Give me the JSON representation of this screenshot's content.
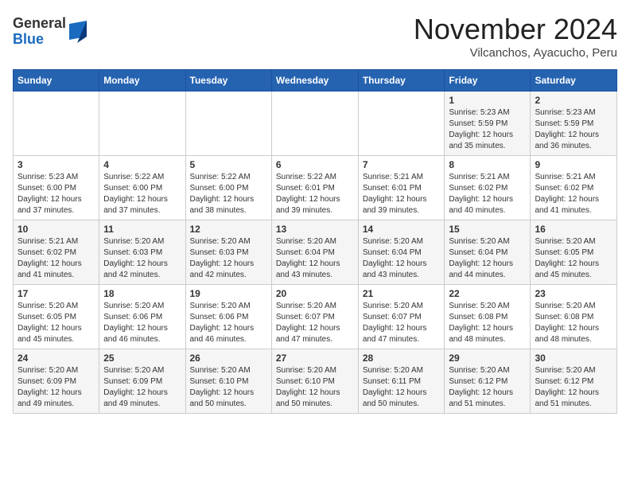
{
  "header": {
    "logo_general": "General",
    "logo_blue": "Blue",
    "month": "November 2024",
    "location": "Vilcanchos, Ayacucho, Peru"
  },
  "weekdays": [
    "Sunday",
    "Monday",
    "Tuesday",
    "Wednesday",
    "Thursday",
    "Friday",
    "Saturday"
  ],
  "weeks": [
    [
      {
        "day": "",
        "info": ""
      },
      {
        "day": "",
        "info": ""
      },
      {
        "day": "",
        "info": ""
      },
      {
        "day": "",
        "info": ""
      },
      {
        "day": "",
        "info": ""
      },
      {
        "day": "1",
        "info": "Sunrise: 5:23 AM\nSunset: 5:59 PM\nDaylight: 12 hours and 35 minutes."
      },
      {
        "day": "2",
        "info": "Sunrise: 5:23 AM\nSunset: 5:59 PM\nDaylight: 12 hours and 36 minutes."
      }
    ],
    [
      {
        "day": "3",
        "info": "Sunrise: 5:23 AM\nSunset: 6:00 PM\nDaylight: 12 hours and 37 minutes."
      },
      {
        "day": "4",
        "info": "Sunrise: 5:22 AM\nSunset: 6:00 PM\nDaylight: 12 hours and 37 minutes."
      },
      {
        "day": "5",
        "info": "Sunrise: 5:22 AM\nSunset: 6:00 PM\nDaylight: 12 hours and 38 minutes."
      },
      {
        "day": "6",
        "info": "Sunrise: 5:22 AM\nSunset: 6:01 PM\nDaylight: 12 hours and 39 minutes."
      },
      {
        "day": "7",
        "info": "Sunrise: 5:21 AM\nSunset: 6:01 PM\nDaylight: 12 hours and 39 minutes."
      },
      {
        "day": "8",
        "info": "Sunrise: 5:21 AM\nSunset: 6:02 PM\nDaylight: 12 hours and 40 minutes."
      },
      {
        "day": "9",
        "info": "Sunrise: 5:21 AM\nSunset: 6:02 PM\nDaylight: 12 hours and 41 minutes."
      }
    ],
    [
      {
        "day": "10",
        "info": "Sunrise: 5:21 AM\nSunset: 6:02 PM\nDaylight: 12 hours and 41 minutes."
      },
      {
        "day": "11",
        "info": "Sunrise: 5:20 AM\nSunset: 6:03 PM\nDaylight: 12 hours and 42 minutes."
      },
      {
        "day": "12",
        "info": "Sunrise: 5:20 AM\nSunset: 6:03 PM\nDaylight: 12 hours and 42 minutes."
      },
      {
        "day": "13",
        "info": "Sunrise: 5:20 AM\nSunset: 6:04 PM\nDaylight: 12 hours and 43 minutes."
      },
      {
        "day": "14",
        "info": "Sunrise: 5:20 AM\nSunset: 6:04 PM\nDaylight: 12 hours and 43 minutes."
      },
      {
        "day": "15",
        "info": "Sunrise: 5:20 AM\nSunset: 6:04 PM\nDaylight: 12 hours and 44 minutes."
      },
      {
        "day": "16",
        "info": "Sunrise: 5:20 AM\nSunset: 6:05 PM\nDaylight: 12 hours and 45 minutes."
      }
    ],
    [
      {
        "day": "17",
        "info": "Sunrise: 5:20 AM\nSunset: 6:05 PM\nDaylight: 12 hours and 45 minutes."
      },
      {
        "day": "18",
        "info": "Sunrise: 5:20 AM\nSunset: 6:06 PM\nDaylight: 12 hours and 46 minutes."
      },
      {
        "day": "19",
        "info": "Sunrise: 5:20 AM\nSunset: 6:06 PM\nDaylight: 12 hours and 46 minutes."
      },
      {
        "day": "20",
        "info": "Sunrise: 5:20 AM\nSunset: 6:07 PM\nDaylight: 12 hours and 47 minutes."
      },
      {
        "day": "21",
        "info": "Sunrise: 5:20 AM\nSunset: 6:07 PM\nDaylight: 12 hours and 47 minutes."
      },
      {
        "day": "22",
        "info": "Sunrise: 5:20 AM\nSunset: 6:08 PM\nDaylight: 12 hours and 48 minutes."
      },
      {
        "day": "23",
        "info": "Sunrise: 5:20 AM\nSunset: 6:08 PM\nDaylight: 12 hours and 48 minutes."
      }
    ],
    [
      {
        "day": "24",
        "info": "Sunrise: 5:20 AM\nSunset: 6:09 PM\nDaylight: 12 hours and 49 minutes."
      },
      {
        "day": "25",
        "info": "Sunrise: 5:20 AM\nSunset: 6:09 PM\nDaylight: 12 hours and 49 minutes."
      },
      {
        "day": "26",
        "info": "Sunrise: 5:20 AM\nSunset: 6:10 PM\nDaylight: 12 hours and 50 minutes."
      },
      {
        "day": "27",
        "info": "Sunrise: 5:20 AM\nSunset: 6:10 PM\nDaylight: 12 hours and 50 minutes."
      },
      {
        "day": "28",
        "info": "Sunrise: 5:20 AM\nSunset: 6:11 PM\nDaylight: 12 hours and 50 minutes."
      },
      {
        "day": "29",
        "info": "Sunrise: 5:20 AM\nSunset: 6:12 PM\nDaylight: 12 hours and 51 minutes."
      },
      {
        "day": "30",
        "info": "Sunrise: 5:20 AM\nSunset: 6:12 PM\nDaylight: 12 hours and 51 minutes."
      }
    ]
  ]
}
